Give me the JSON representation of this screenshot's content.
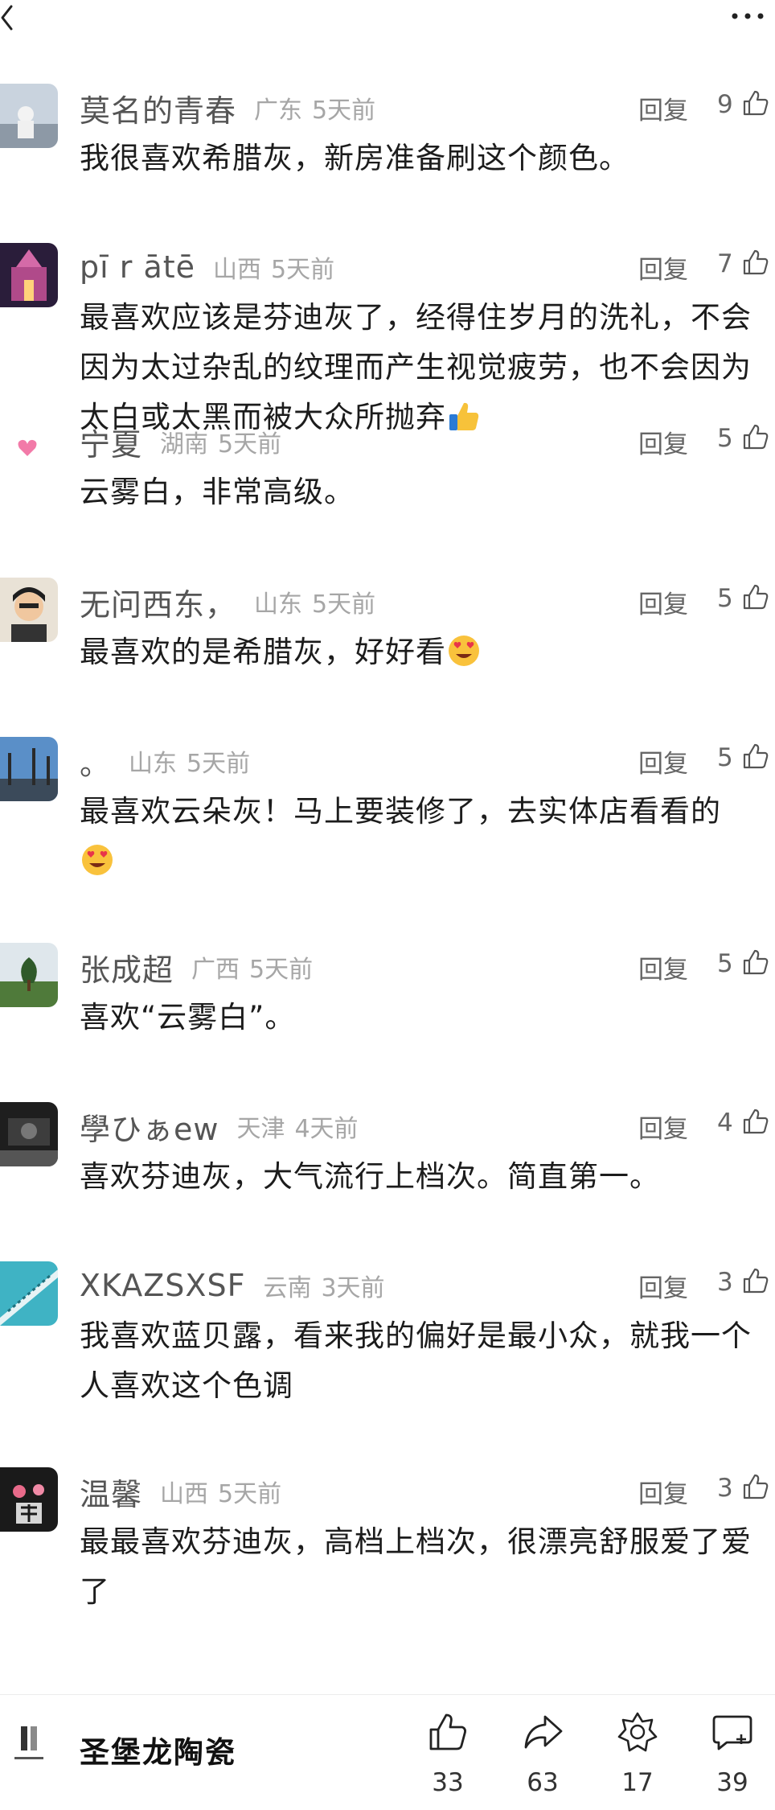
{
  "header": {
    "back_icon": "chevron-left-icon",
    "more_icon": "more-dots-icon"
  },
  "reply_label": "回复",
  "comments": [
    {
      "username": "莫名的青春",
      "region": "广东",
      "time": "5天前",
      "likes": "9",
      "text": "我很喜欢希腊灰，新房准备刷这个颜色。"
    },
    {
      "username": "pī r ātē",
      "region": "山西",
      "time": "5天前",
      "likes": "7",
      "text": "最喜欢应该是芬迪灰了，经得住岁月的洗礼，不会因为太过杂乱的纹理而产生视觉疲劳，也不会因为太白或太黑而被大众所抛弃",
      "emoji": "thumbs-up-emoji"
    },
    {
      "username": "宁夏",
      "region": "湖南",
      "time": "5天前",
      "likes": "5",
      "text": "云雾白，非常高级。"
    },
    {
      "username": "无问西东，",
      "region": "山东",
      "time": "5天前",
      "likes": "5",
      "text": "最喜欢的是希腊灰，好好看",
      "emoji": "heart-eyes-emoji"
    },
    {
      "username": "。",
      "region": "山东",
      "time": "5天前",
      "likes": "5",
      "text": "最喜欢云朵灰！马上要装修了，去实体店看看的",
      "emoji": "heart-eyes-emoji"
    },
    {
      "username": "张成超",
      "region": "广西",
      "time": "5天前",
      "likes": "5",
      "text": "喜欢“云雾白”。"
    },
    {
      "username": "學ひぁew",
      "region": "天津",
      "time": "4天前",
      "likes": "4",
      "text": "喜欢芬迪灰，大气流行上档次。简直第一。"
    },
    {
      "username": "XKAZSXSF",
      "region": "云南",
      "time": "3天前",
      "likes": "3",
      "text": "我喜欢蓝贝露，看来我的偏好是最小众，就我一个人喜欢这个色调"
    },
    {
      "username": "温馨",
      "region": "山西",
      "time": "5天前",
      "likes": "3",
      "text": "最最喜欢芬迪灰，高档上档次，很漂亮舒服爱了爱了"
    }
  ],
  "bottom_bar": {
    "brand_name": "圣堡龙陶瓷",
    "actions": [
      {
        "name": "like",
        "icon": "thumbs-up-icon",
        "count": "33"
      },
      {
        "name": "share",
        "icon": "share-arrow-icon",
        "count": "63"
      },
      {
        "name": "favorite",
        "icon": "star-badge-icon",
        "count": "17"
      },
      {
        "name": "comment",
        "icon": "comment-plus-icon",
        "count": "39"
      }
    ]
  },
  "colors": {
    "username": "#555555",
    "meta": "#a6a6a6",
    "text": "#1c1c1c"
  }
}
